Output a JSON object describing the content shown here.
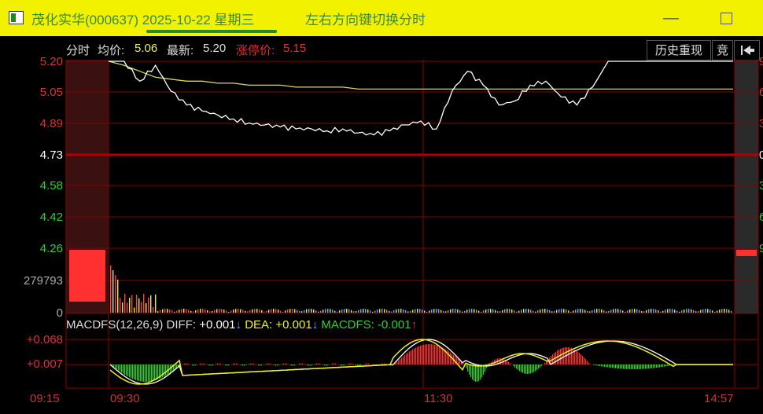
{
  "window": {
    "title": "茂化实华(000637) 2025-10-22 星期三",
    "hint": "左右方向键切换分时",
    "minimize_glyph": "—",
    "colors": {
      "titlebar": "#f2f200",
      "title_text": "#3a8a3a"
    }
  },
  "header": {
    "mode_label": "分时",
    "avg_label": "均价:",
    "avg_value": "5.06",
    "last_label": "最新:",
    "last_value": "5.20",
    "limit_label": "涨停价:",
    "limit_value": "5.15",
    "history_button": "历史重现",
    "auction_button": "竞",
    "jump_icon": "jump-to-start-icon"
  },
  "price_axis": {
    "labels": [
      "5.20",
      "5.05",
      "4.89",
      "4.73",
      "4.58",
      "4.42",
      "4.26"
    ],
    "colors": [
      "#e03030",
      "#e03030",
      "#e03030",
      "#ffffff",
      "#30d030",
      "#30d030",
      "#30d030"
    ]
  },
  "right_axis_digits": [
    "9",
    "6",
    "3",
    "0",
    "3",
    "6",
    "9"
  ],
  "volume_axis": {
    "labels": [
      "279793",
      "0"
    ]
  },
  "macd": {
    "name": "MACDFS(12,26,9)",
    "diff_label": "DIFF:",
    "diff_value": "+0.001",
    "diff_arrow": "↓",
    "dea_label": "DEA:",
    "dea_value": "+0.001",
    "dea_arrow": "↓",
    "macdfs_label": "MACDFS:",
    "macdfs_value": "-0.001",
    "macdfs_arrow": "↑",
    "axis_labels": [
      "+0.068",
      "+0.007"
    ]
  },
  "time_axis": {
    "labels": [
      "09:15",
      "09:30",
      "11:30",
      "14:57"
    ]
  },
  "chart_data": {
    "type": "line",
    "xlabel": "",
    "ylabel": "",
    "ylim": [
      4.26,
      5.2
    ],
    "grid": true,
    "series": [
      {
        "values": [
          5.2,
          5.2,
          5.1,
          5.18,
          5.05,
          4.98,
          4.95,
          4.93,
          4.91,
          4.89,
          4.88,
          4.87,
          4.86,
          4.86,
          4.85,
          4.86,
          4.84,
          4.83,
          4.85,
          4.88,
          4.9,
          4.86,
          5.05,
          5.15,
          5.08,
          4.98,
          5.0,
          5.08,
          5.1,
          5.02,
          4.98,
          5.07,
          5.2,
          5.2,
          5.2,
          5.2,
          5.2,
          5.2,
          5.2,
          5.2,
          5.2
        ]
      },
      {
        "values": [
          5.2,
          5.18,
          5.15,
          5.12,
          5.11,
          5.1,
          5.1,
          5.09,
          5.09,
          5.08,
          5.08,
          5.08,
          5.07,
          5.07,
          5.07,
          5.07,
          5.06,
          5.06,
          5.06,
          5.06,
          5.06,
          5.06,
          5.06,
          5.06,
          5.06,
          5.06,
          5.06,
          5.06,
          5.06,
          5.06,
          5.06,
          5.06,
          5.06,
          5.06,
          5.06,
          5.06,
          5.06,
          5.06,
          5.06,
          5.06,
          5.06
        ]
      }
    ]
  }
}
